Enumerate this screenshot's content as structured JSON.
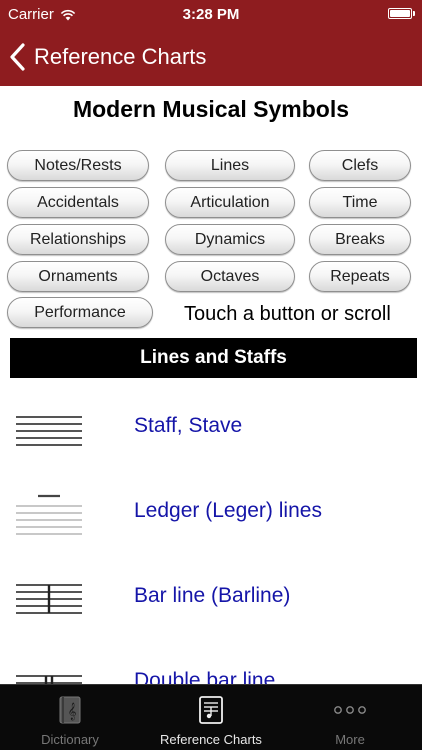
{
  "status_bar": {
    "carrier": "Carrier",
    "time": "3:28 PM"
  },
  "nav": {
    "back_label": "Reference Charts"
  },
  "page": {
    "title": "Modern Musical Symbols",
    "hint": "Touch a button or scroll"
  },
  "category_buttons": [
    "Notes/Rests",
    "Lines",
    "Clefs",
    "Accidentals",
    "Articulation",
    "Time",
    "Relationships",
    "Dynamics",
    "Breaks",
    "Ornaments",
    "Octaves",
    "Repeats",
    "Performance"
  ],
  "section": {
    "title": "Lines and Staffs"
  },
  "symbols": [
    {
      "label": "Staff, Stave",
      "icon": "staff-icon"
    },
    {
      "label": "Ledger (Leger) lines",
      "icon": "ledger-lines-icon"
    },
    {
      "label": "Bar line (Barline)",
      "icon": "bar-line-icon"
    },
    {
      "label": "Double bar line",
      "icon": "double-bar-line-icon"
    }
  ],
  "tab_bar": {
    "tabs": [
      {
        "label": "Dictionary",
        "icon": "dictionary-book-icon",
        "active": false
      },
      {
        "label": "Reference Charts",
        "icon": "reference-charts-icon",
        "active": true
      },
      {
        "label": "More",
        "icon": "more-dots-icon",
        "active": false
      }
    ]
  },
  "colors": {
    "nav_bar": "#8e1c1f",
    "link_text": "#1515a8",
    "section_bar": "#000000",
    "tab_bar": "#0a0a0a"
  }
}
